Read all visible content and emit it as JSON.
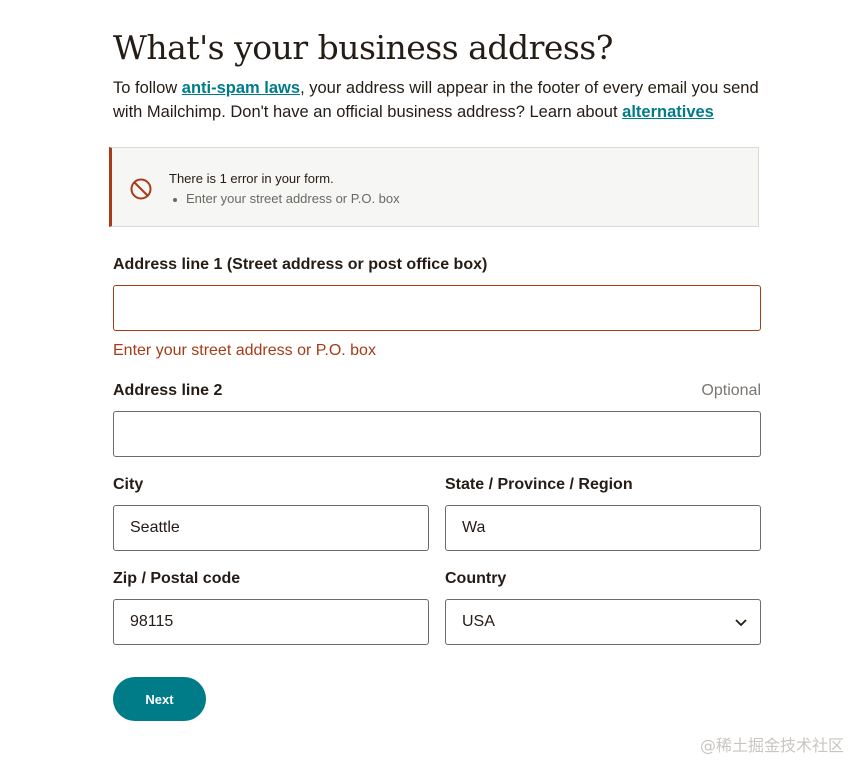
{
  "header": {
    "title": "What's your business address?",
    "intro_before": "To follow ",
    "intro_link_1": "anti-spam laws",
    "intro_middle": ", your address will appear in the footer of every email you send with Mailchimp. Don't have an official business address? Learn about ",
    "intro_link_2": "alternatives"
  },
  "error_summary": {
    "title": "There is 1 error in your form.",
    "items": [
      "Enter your street address or P.O. box"
    ]
  },
  "form": {
    "address1": {
      "label": "Address line 1 (Street address or post office box)",
      "value": "",
      "error": "Enter your street address or P.O. box"
    },
    "address2": {
      "label": "Address line 2",
      "optional": "Optional",
      "value": ""
    },
    "city": {
      "label": "City",
      "value": "Seattle"
    },
    "state": {
      "label": "State / Province / Region",
      "value": "Wa"
    },
    "zip": {
      "label": "Zip / Postal code",
      "value": "98115"
    },
    "country": {
      "label": "Country",
      "value": "USA"
    }
  },
  "actions": {
    "next_label": "Next"
  },
  "watermark": "@稀土掘金技术社区",
  "colors": {
    "accent": "#007c89",
    "error": "#a73b16",
    "text": "#241c15"
  },
  "icons": {
    "error": "prohibited-icon",
    "select": "chevron-down-icon"
  }
}
